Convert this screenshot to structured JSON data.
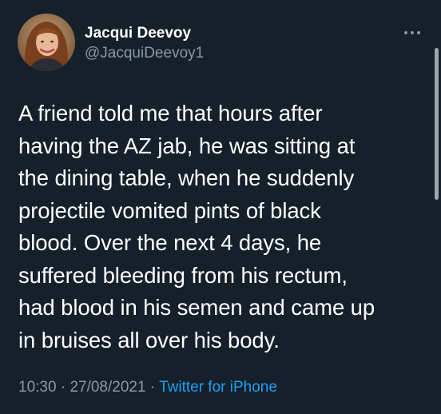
{
  "author": {
    "display_name": "Jacqui Deevoy",
    "handle": "@JacquiDeevoy1",
    "avatar_icon": "profile-photo"
  },
  "menu": {
    "icon": "more-horizontal-icon"
  },
  "tweet": {
    "lines": [
      "A friend told me that hours after",
      "having the AZ jab, he was sitting at",
      "the dining table, when he suddenly",
      "projectile vomited pints of black",
      "blood. Over the next 4 days, he",
      "suffered bleeding from his rectum,",
      "had blood in his semen and came up",
      "in bruises all over his body."
    ]
  },
  "meta": {
    "time": "10:30",
    "separator": " · ",
    "date": "27/08/2021",
    "source": "Twitter for iPhone"
  },
  "colors": {
    "background": "#15202b",
    "text": "#ffffff",
    "secondary_text": "#8899a6",
    "link": "#1da1f2"
  }
}
